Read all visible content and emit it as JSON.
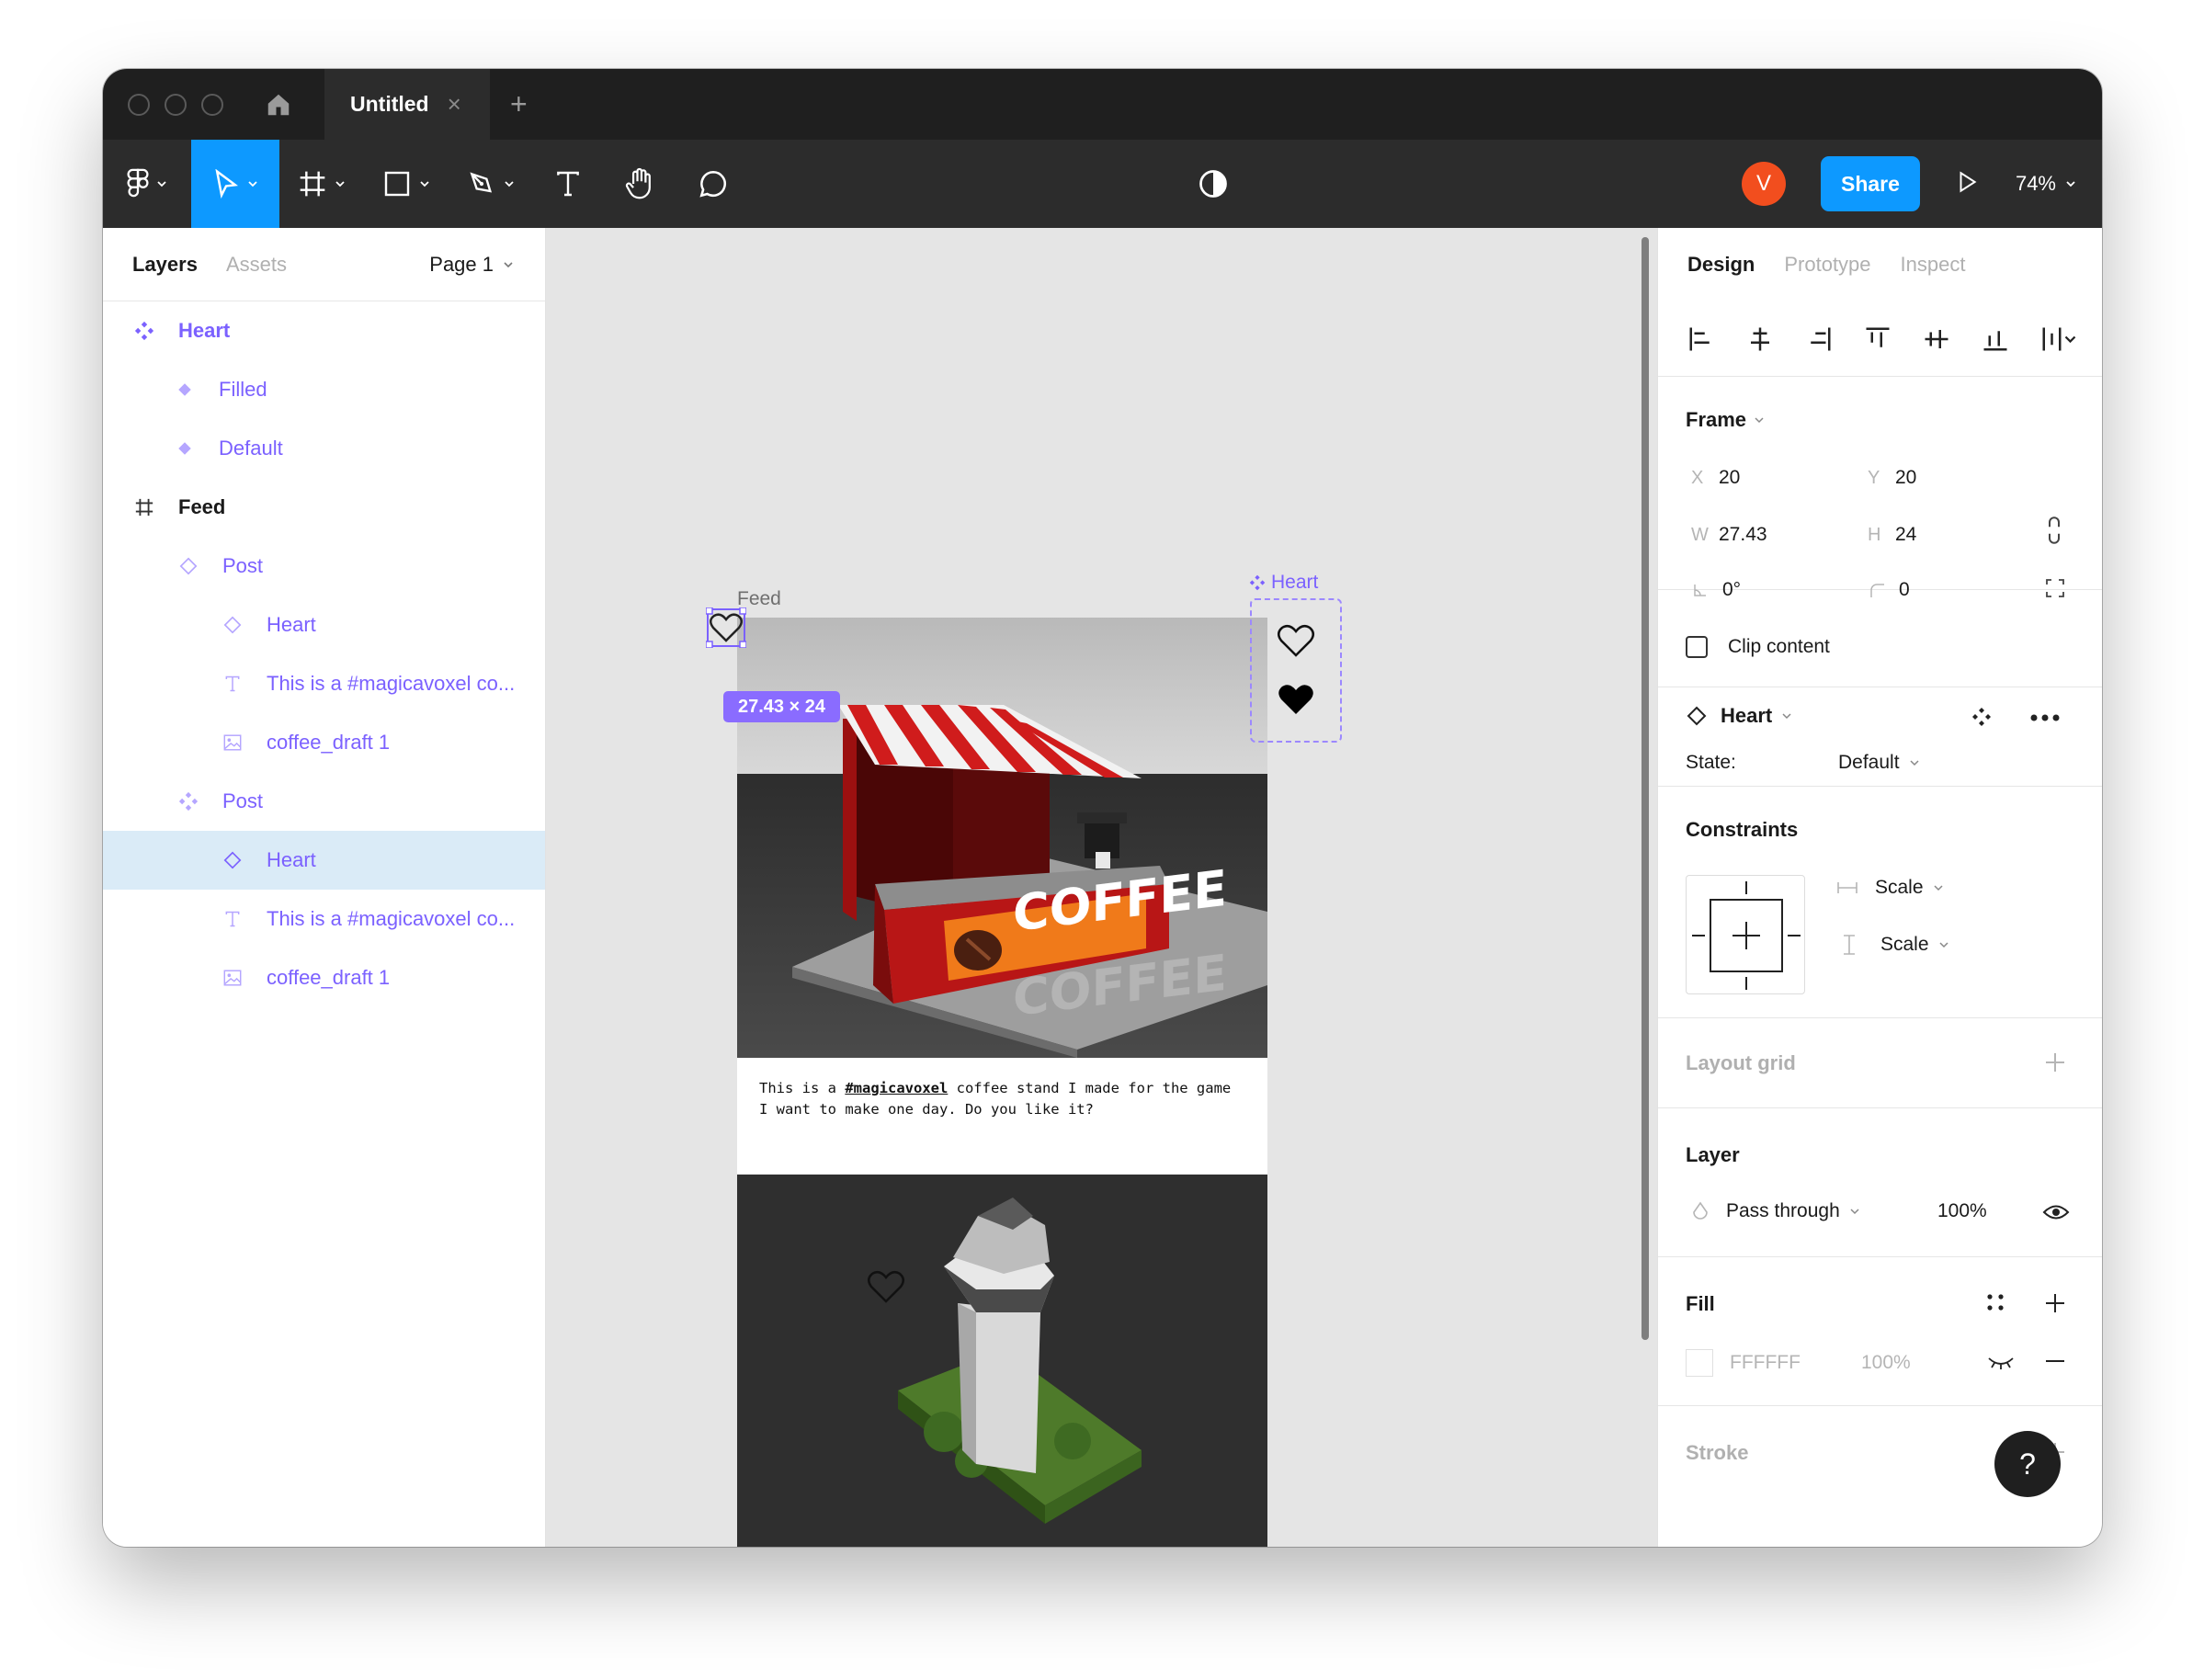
{
  "titlebar": {
    "tab_title": "Untitled",
    "tab_close": "×",
    "new_tab": "+"
  },
  "toolbar": {
    "avatar_initial": "V",
    "share_label": "Share",
    "zoom": "74%"
  },
  "left_panel": {
    "tab_layers": "Layers",
    "tab_assets": "Assets",
    "page": "Page 1",
    "layers": [
      {
        "label": "Heart",
        "icon": "component-set-icon"
      },
      {
        "label": "Filled",
        "icon": "variant-icon"
      },
      {
        "label": "Default",
        "icon": "variant-icon"
      },
      {
        "label": "Feed",
        "icon": "frame-icon"
      },
      {
        "label": "Post",
        "icon": "instance-icon"
      },
      {
        "label": "Heart",
        "icon": "instance-icon"
      },
      {
        "label": "This is a #magicavoxel co...",
        "icon": "text-icon"
      },
      {
        "label": "coffee_draft 1",
        "icon": "image-icon"
      },
      {
        "label": "Post",
        "icon": "component-icon"
      },
      {
        "label": "Heart",
        "icon": "instance-icon"
      },
      {
        "label": "This is a #magicavoxel co...",
        "icon": "text-icon"
      },
      {
        "label": "coffee_draft 1",
        "icon": "image-icon"
      }
    ]
  },
  "canvas": {
    "feed_label": "Feed",
    "heart_component_label": "Heart",
    "dimension_badge": "27.43 × 24",
    "post_caption_pre": "This is a ",
    "post_caption_tag": "#magicavoxel",
    "post_caption_post": " coffee stand I made for the game I want to make one day. Do you like it?",
    "sign_text": "COFFEE"
  },
  "right_panel": {
    "tab_design": "Design",
    "tab_prototype": "Prototype",
    "tab_inspect": "Inspect",
    "frame_title": "Frame",
    "x_label": "X",
    "x_value": "20",
    "y_label": "Y",
    "y_value": "20",
    "w_label": "W",
    "w_value": "27.43",
    "h_label": "H",
    "h_value": "24",
    "rotation": "0°",
    "radius": "0",
    "clip_content": "Clip content",
    "instance_name": "Heart",
    "state_label": "State:",
    "state_value": "Default",
    "constraints_title": "Constraints",
    "constraint_h": "Scale",
    "constraint_v": "Scale",
    "layout_grid": "Layout grid",
    "layer_title": "Layer",
    "blend_mode": "Pass through",
    "layer_opacity": "100%",
    "fill_title": "Fill",
    "fill_hex": "FFFFFF",
    "fill_opacity": "100%",
    "stroke_title": "Stroke"
  },
  "help": "?",
  "colors": {
    "accent": "#0d99ff",
    "component": "#7b61ff",
    "avatar": "#f24e1e",
    "toolbar": "#2c2c2c",
    "titlebar": "#1f1f1f"
  }
}
